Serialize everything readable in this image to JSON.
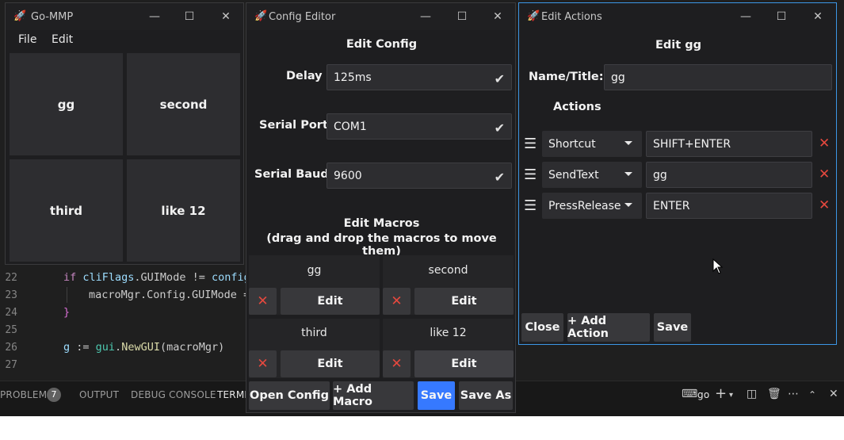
{
  "editor": {
    "lines": [
      {
        "no": "22",
        "pre": "",
        "kw": "if",
        "rest_var": " cliFlags",
        "rest": ".GUIMode != ",
        "tail_var": "config"
      },
      {
        "no": "23",
        "text": "macroMgr.Config.GUIMode ="
      },
      {
        "no": "24",
        "text": "}"
      },
      {
        "no": "25",
        "text": ""
      },
      {
        "no": "26",
        "var": "g",
        "op": " := ",
        "pkg": "gui",
        "dot": ".",
        "fn": "NewGUI",
        "arg": "(macroMgr)"
      },
      {
        "no": "27",
        "text": ""
      }
    ]
  },
  "panel": {
    "tabs": [
      "PROBLEMS",
      "OUTPUT",
      "DEBUG CONSOLE",
      "TERMI"
    ],
    "problems_count": "7",
    "terminal_label": "go"
  },
  "main_window": {
    "title": "Go-MMP",
    "menu": [
      "File",
      "Edit"
    ],
    "tiles": [
      "gg",
      "second",
      "third",
      "like 12"
    ]
  },
  "config_editor": {
    "title": "Config Editor",
    "heading": "Edit Config",
    "fields": [
      {
        "label": "Delay",
        "value": "125ms"
      },
      {
        "label": "Serial Port",
        "value": "COM1"
      },
      {
        "label": "Serial Baud",
        "value": "9600"
      }
    ],
    "macros_heading": "Edit Macros",
    "macros_subheading": "(drag and drop the macros to move them)",
    "macros": [
      "gg",
      "second",
      "third",
      "like 12"
    ],
    "edit_label": "Edit",
    "buttons": {
      "open_config": "Open Config",
      "add_macro": "+ Add Macro",
      "save": "Save",
      "save_as": "Save As"
    }
  },
  "edit_actions": {
    "title": "Edit Actions",
    "heading": "Edit gg",
    "name_label": "Name/Title:",
    "name_value": "gg",
    "actions_heading": "Actions",
    "actions": [
      {
        "type": "Shortcut",
        "value": "SHIFT+ENTER"
      },
      {
        "type": "SendText",
        "value": "gg"
      },
      {
        "type": "PressRelease",
        "value": "ENTER"
      }
    ],
    "buttons": {
      "close": "Close",
      "add_action": "+ Add Action",
      "save": "Save"
    }
  },
  "colors": {
    "accent": "#3679ff",
    "danger": "#e5483e",
    "focus_border": "#3c96e6"
  }
}
